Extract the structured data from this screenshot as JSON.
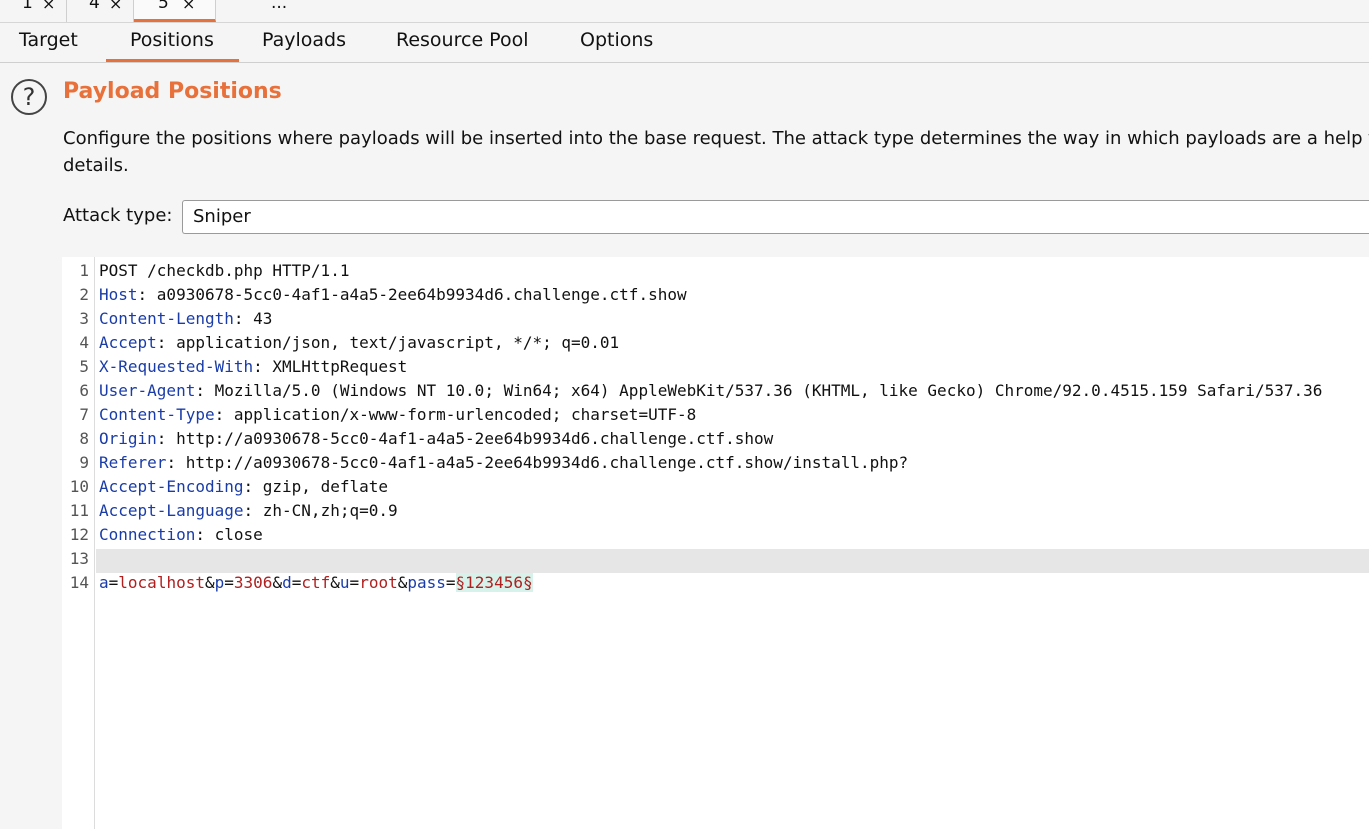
{
  "top_tabs": [
    {
      "label": "1",
      "close": "×"
    },
    {
      "label": "4",
      "close": "×"
    },
    {
      "label": "5",
      "close": "×"
    },
    {
      "label": "..."
    }
  ],
  "sub_tabs": [
    "Target",
    "Positions",
    "Payloads",
    "Resource Pool",
    "Options"
  ],
  "section": {
    "help_icon_glyph": "?",
    "title": "Payload Positions",
    "description": "Configure the positions where payloads will be inserted into the base request. The attack type determines the way in which payloads are a help for full details."
  },
  "attack": {
    "label": "Attack type:",
    "value": "Sniper"
  },
  "editor": {
    "line_numbers": [
      "1",
      "2",
      "3",
      "4",
      "5",
      "6",
      "7",
      "8",
      "9",
      "10",
      "11",
      "12",
      "13",
      "14"
    ],
    "request_line": "POST /checkdb.php HTTP/1.1",
    "headers": [
      {
        "key": "Host",
        "value": "a0930678-5cc0-4af1-a4a5-2ee64b9934d6.challenge.ctf.show"
      },
      {
        "key": "Content-Length",
        "value": "43"
      },
      {
        "key": "Accept",
        "value": "application/json, text/javascript, */*; q=0.01"
      },
      {
        "key": "X-Requested-With",
        "value": "XMLHttpRequest"
      },
      {
        "key": "User-Agent",
        "value": "Mozilla/5.0 (Windows NT 10.0; Win64; x64) AppleWebKit/537.36 (KHTML, like Gecko) Chrome/92.0.4515.159 Safari/537.36"
      },
      {
        "key": "Content-Type",
        "value": "application/x-www-form-urlencoded; charset=UTF-8"
      },
      {
        "key": "Origin",
        "value": "http://a0930678-5cc0-4af1-a4a5-2ee64b9934d6.challenge.ctf.show"
      },
      {
        "key": "Referer",
        "value": "http://a0930678-5cc0-4af1-a4a5-2ee64b9934d6.challenge.ctf.show/install.php?"
      },
      {
        "key": "Accept-Encoding",
        "value": "gzip, deflate"
      },
      {
        "key": "Accept-Language",
        "value": "zh-CN,zh;q=0.9"
      },
      {
        "key": "Connection",
        "value": "close"
      }
    ],
    "body_params": [
      {
        "key": "a",
        "value": "localhost"
      },
      {
        "key": "p",
        "value": "3306"
      },
      {
        "key": "d",
        "value": "ctf"
      },
      {
        "key": "u",
        "value": "root"
      },
      {
        "key": "pass",
        "value": ""
      }
    ],
    "sep_eq": "=",
    "sep_amp": "&",
    "header_sep": ": ",
    "payload_marked": "§123456§"
  }
}
